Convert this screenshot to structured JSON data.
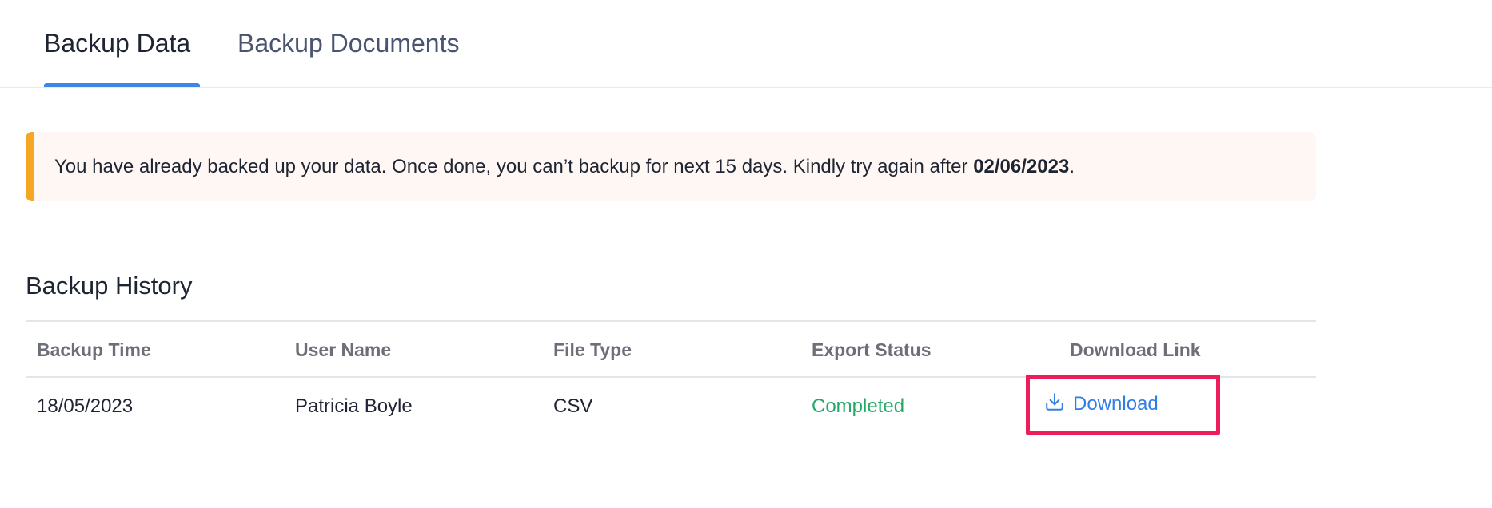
{
  "tabs": [
    {
      "label": "Backup Data",
      "active": true
    },
    {
      "label": "Backup Documents",
      "active": false
    }
  ],
  "alert": {
    "message": "You have already backed up your data. Once done, you can’t backup for next 15 days. Kindly try again after ",
    "date": "02/06/2023",
    "suffix": "."
  },
  "history": {
    "title": "Backup History",
    "columns": [
      "Backup Time",
      "User Name",
      "File Type",
      "Export Status",
      "Download Link"
    ],
    "rows": [
      {
        "backup_time": "18/05/2023",
        "user_name": "Patricia Boyle",
        "file_type": "CSV",
        "export_status": "Completed",
        "download_label": "Download"
      }
    ]
  },
  "colors": {
    "accent": "#3d86e8",
    "alert_border": "#f5a623",
    "status_completed": "#27a869",
    "link": "#2f7ee6",
    "highlight_box": "#ee1d5a"
  },
  "icons": {
    "download": "download-icon"
  }
}
